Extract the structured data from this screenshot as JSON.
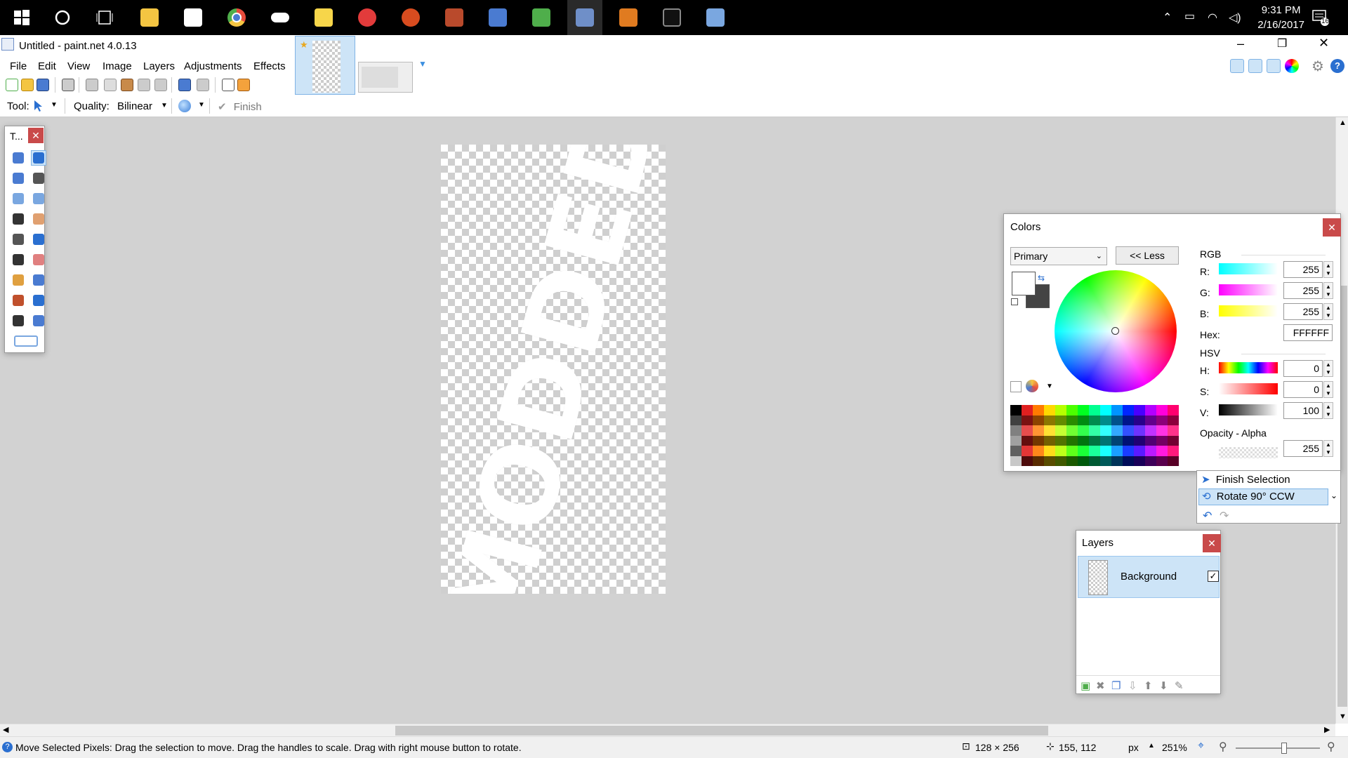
{
  "taskbar": {
    "time": "9:31 PM",
    "date": "2/16/2017",
    "notification_count": "16",
    "icons": [
      {
        "name": "windows-start-icon",
        "color": "#ffffff"
      },
      {
        "name": "cortana-icon",
        "color": "#ffffff"
      },
      {
        "name": "task-view-icon",
        "color": "#ffffff"
      },
      {
        "name": "file-explorer-icon",
        "color": "#f4c542"
      },
      {
        "name": "store-icon",
        "color": "#ffffff"
      },
      {
        "name": "chrome-icon",
        "color": "#e84c3d"
      },
      {
        "name": "gamepad-icon",
        "color": "#ffffff"
      },
      {
        "name": "sticky-notes-icon",
        "color": "#f7d64a"
      },
      {
        "name": "smash-icon",
        "color": "#e23b3b"
      },
      {
        "name": "game-app-icon",
        "color": "#d84c1f"
      },
      {
        "name": "archive-icon",
        "color": "#b94a2c"
      },
      {
        "name": "doc-app-icon",
        "color": "#4a7bd1"
      },
      {
        "name": "image-app-icon",
        "color": "#4fae4b"
      },
      {
        "name": "paintnet-icon",
        "color": "#6f8fc8"
      },
      {
        "name": "java-icon",
        "color": "#e07b20"
      },
      {
        "name": "terminal-icon",
        "color": "#888888"
      },
      {
        "name": "notepad-icon",
        "color": "#7aa7e0"
      }
    ]
  },
  "window": {
    "title": "Untitled - paint.net 4.0.13",
    "menu": [
      "File",
      "Edit",
      "View",
      "Image",
      "Layers",
      "Adjustments",
      "Effects"
    ]
  },
  "toolbar": {
    "tool_label": "Tool:",
    "quality_label": "Quality:",
    "quality_value": "Bilinear",
    "finish_label": "Finish"
  },
  "canvas": {
    "text": "MODDED"
  },
  "tools_panel": {
    "title": "T..."
  },
  "colors_panel": {
    "title": "Colors",
    "mode": "Primary",
    "less_button": "<< Less",
    "rgb_label": "RGB",
    "r_label": "R:",
    "g_label": "G:",
    "b_label": "B:",
    "hex_label": "Hex:",
    "hsv_label": "HSV",
    "h_label": "H:",
    "s_label": "S:",
    "v_label": "V:",
    "opacity_label": "Opacity - Alpha",
    "r": "255",
    "g": "255",
    "b": "255",
    "hex": "FFFFFF",
    "h": "0",
    "s": "0",
    "v": "100",
    "alpha": "255"
  },
  "history_panel": {
    "items": [
      "Finish Selection",
      "Rotate 90° CCW"
    ]
  },
  "layers_panel": {
    "title": "Layers",
    "layer_name": "Background"
  },
  "statusbar": {
    "message": "Move Selected Pixels: Drag the selection to move. Drag the handles to scale. Drag with right mouse button to rotate.",
    "image_size": "128 × 256",
    "cursor_pos": "155, 112",
    "units": "px",
    "zoom": "251%"
  }
}
